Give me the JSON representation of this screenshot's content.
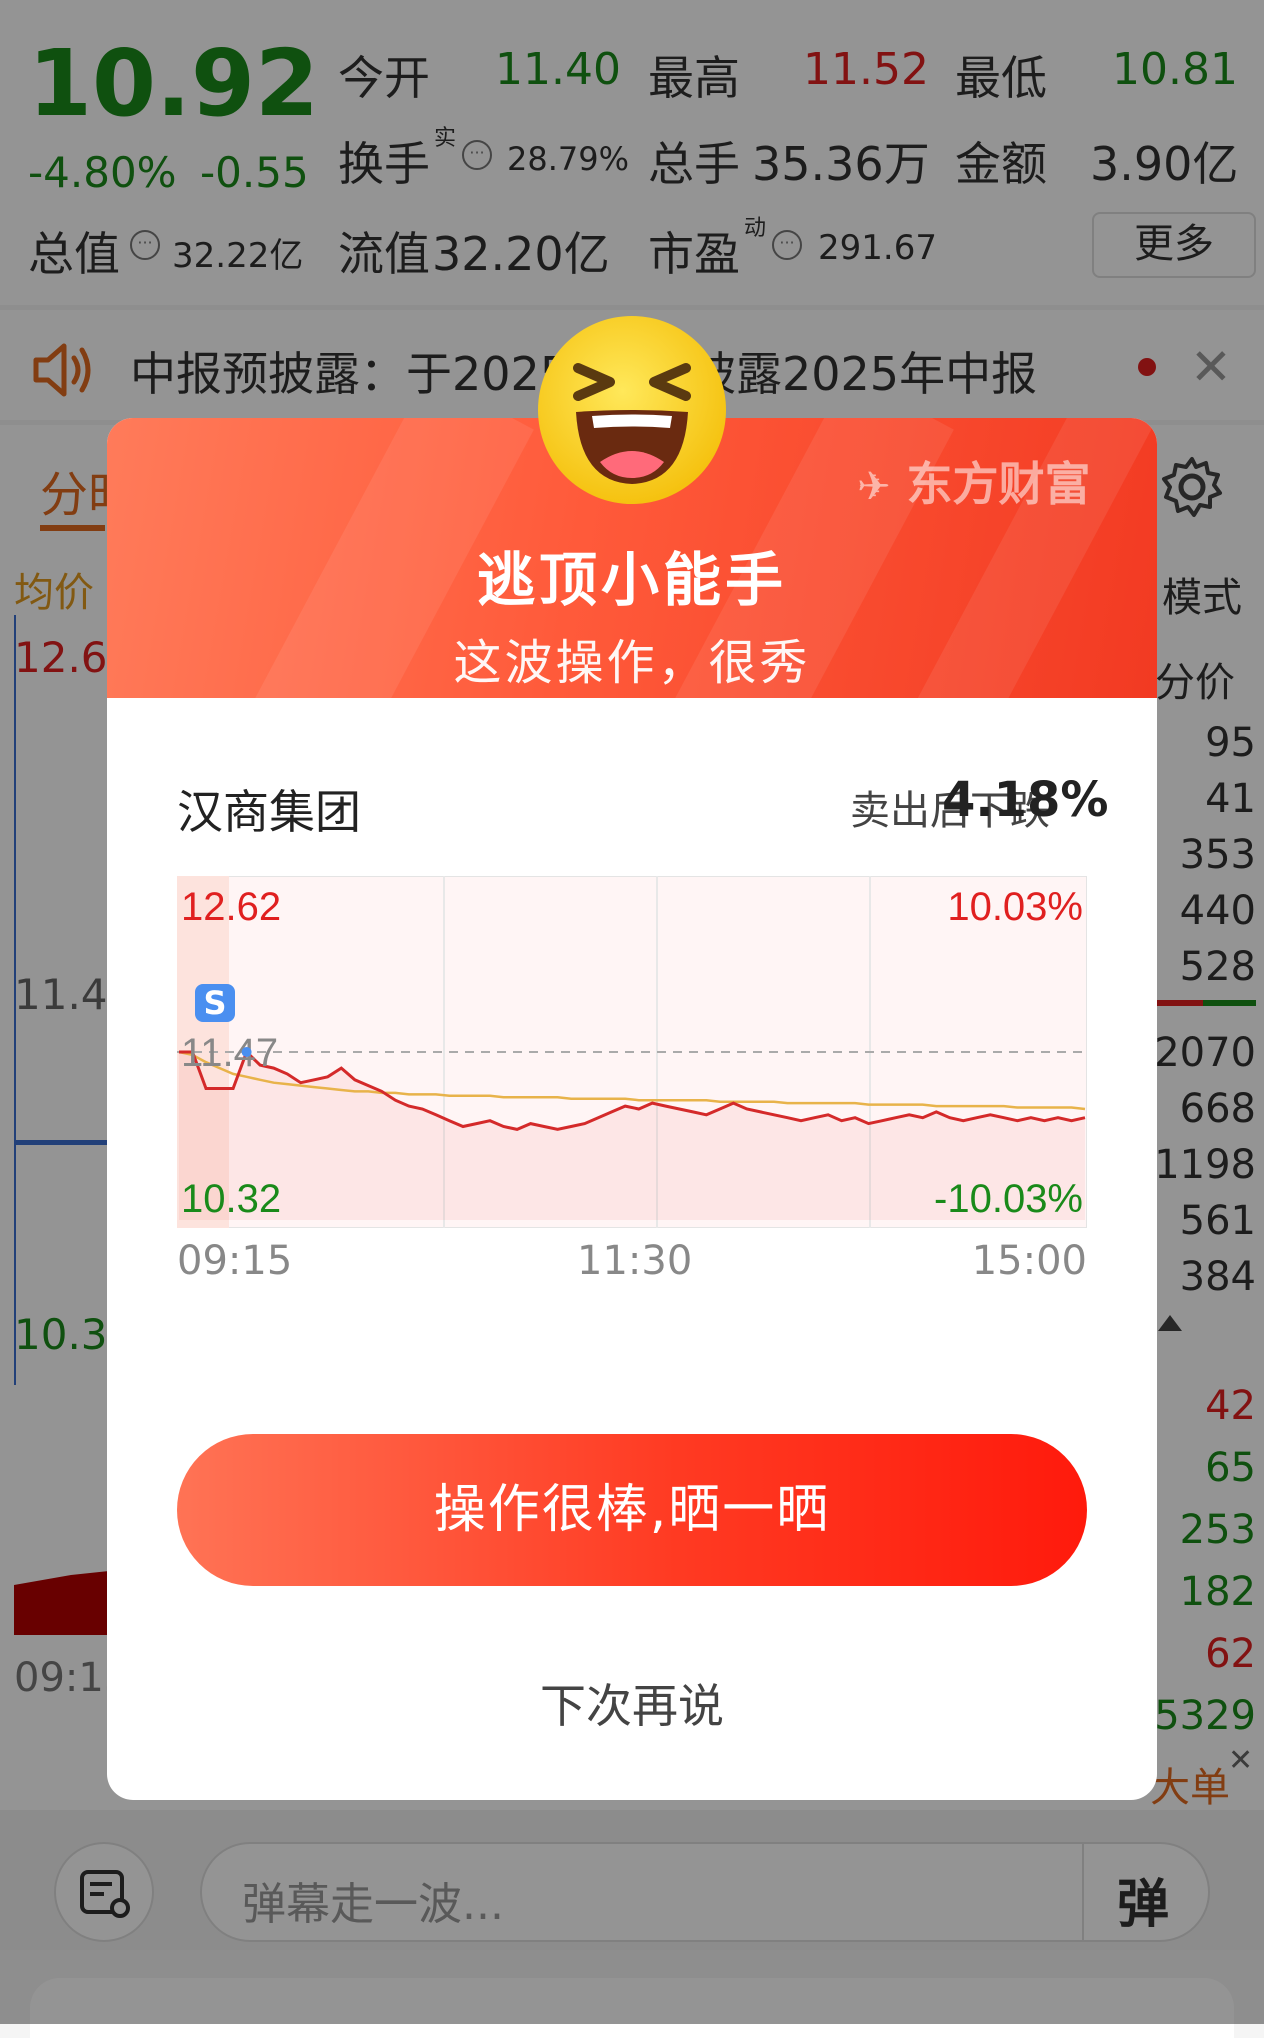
{
  "quote": {
    "price": "10.92",
    "pct_change": "-4.80%",
    "change": "-0.55",
    "open_label": "今开",
    "open_value": "11.40",
    "high_label": "最高",
    "high_value": "11.52",
    "low_label": "最低",
    "low_value": "10.81",
    "turnover_label": "换手",
    "turnover_sup": "实",
    "turnover_value": "28.79%",
    "volume_label": "总手",
    "volume_value": "35.36万",
    "amount_label": "金额",
    "amount_value": "3.90亿",
    "mcap_label": "总值",
    "mcap_value": "32.22亿",
    "float_label": "流值",
    "float_value": "32.20亿",
    "pe_label": "市盈",
    "pe_sup": "动",
    "pe_value": "291.67",
    "more_label": "更多"
  },
  "notice": {
    "text_left": "中报预披露：于2025",
    "text_right": "披露2025年中报"
  },
  "background": {
    "tab_partial": "分时",
    "avg_label": "均价",
    "mode_label": "模式",
    "fenjia_label": "分价",
    "y_top": "12.62",
    "y_mid": "11.47",
    "y_bot": "10.32",
    "time_left": "09:15",
    "right_numbers_top": [
      "95",
      "41",
      "353",
      "440",
      "528"
    ],
    "right_numbers_mid": [
      "2070",
      "668",
      "1198",
      "561",
      "384"
    ],
    "right_numbers_bottom": [
      "42",
      "65",
      "253",
      "182",
      "62",
      "5329"
    ],
    "big_order_label": "大单",
    "danmu_placeholder": "弹幕走一波...",
    "danmu_button": "弹"
  },
  "dialog": {
    "title": "逃顶小能手",
    "subtitle": "这波操作，很秀",
    "brand": "东方财富",
    "stock_name": "汉商集团",
    "drop_label": "卖出后下跌",
    "drop_value": "4.18%",
    "share_button": "操作很棒,晒一晒",
    "later_button": "下次再说",
    "sell_marker": "S"
  },
  "chart_data": {
    "type": "line",
    "title": "",
    "x_ticks": [
      "09:15",
      "11:30",
      "15:00"
    ],
    "y_left_ticks": [
      "12.62",
      "11.47",
      "10.32"
    ],
    "y_right_ticks": [
      "10.03%",
      "-10.03%"
    ],
    "ylim": [
      10.32,
      12.62
    ],
    "prev_close": 11.47,
    "series": [
      {
        "values": [
          11.47,
          11.47,
          11.22,
          11.22,
          11.22,
          11.47,
          11.38,
          11.36,
          11.32,
          11.26,
          11.28,
          11.3,
          11.36,
          11.28,
          11.24,
          11.2,
          11.14,
          11.1,
          11.08,
          11.04,
          11.0,
          10.96,
          10.98,
          11.0,
          10.96,
          10.94,
          10.98,
          10.96,
          10.94,
          10.96,
          10.98,
          11.02,
          11.06,
          11.1,
          11.08,
          11.12,
          11.1,
          11.08,
          11.06,
          11.04,
          11.08,
          11.12,
          11.08,
          11.06,
          11.04,
          11.02,
          11.0,
          11.02,
          11.04,
          11.0,
          11.02,
          10.98,
          11.0,
          11.02,
          11.04,
          11.02,
          11.06,
          11.02,
          11.0,
          11.02,
          11.04,
          11.02,
          11.0,
          11.02,
          11.0,
          11.02,
          11.0,
          11.02
        ]
      },
      {
        "values": [
          11.47,
          11.45,
          11.4,
          11.36,
          11.32,
          11.3,
          11.28,
          11.26,
          11.25,
          11.24,
          11.23,
          11.22,
          11.21,
          11.2,
          11.2,
          11.19,
          11.19,
          11.18,
          11.18,
          11.18,
          11.17,
          11.17,
          11.17,
          11.17,
          11.16,
          11.16,
          11.16,
          11.16,
          11.16,
          11.15,
          11.15,
          11.15,
          11.15,
          11.15,
          11.14,
          11.14,
          11.14,
          11.14,
          11.14,
          11.14,
          11.13,
          11.13,
          11.13,
          11.13,
          11.13,
          11.12,
          11.12,
          11.12,
          11.12,
          11.12,
          11.12,
          11.11,
          11.11,
          11.11,
          11.11,
          11.11,
          11.1,
          11.1,
          11.1,
          11.1,
          11.1,
          11.1,
          11.09,
          11.09,
          11.09,
          11.09,
          11.09,
          11.08
        ]
      }
    ]
  },
  "colors": {
    "up": "#e02020",
    "down": "#1a8a1a",
    "price_line": "#d42a2a",
    "avg_line": "#e8b34a",
    "accent": "#ff3a22"
  }
}
